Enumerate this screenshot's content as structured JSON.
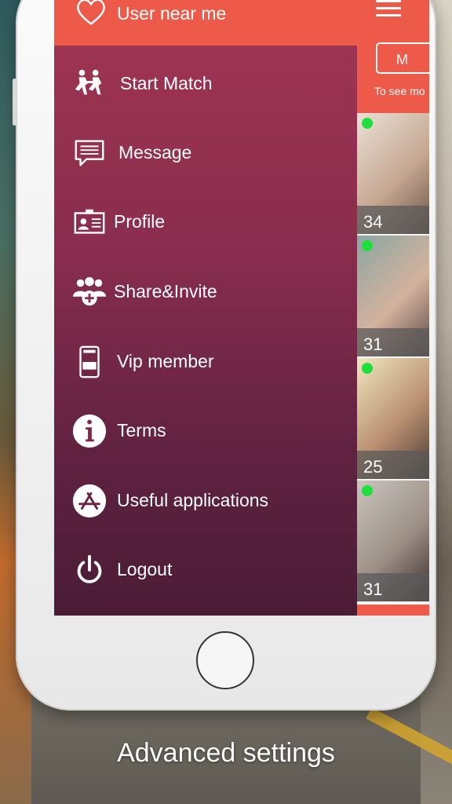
{
  "menu": {
    "header": {
      "label": "User near me",
      "icon": "heart-icon"
    },
    "items": [
      {
        "label": "Start Match",
        "icon": "running-people-icon"
      },
      {
        "label": "Message",
        "icon": "message-icon"
      },
      {
        "label": "Profile",
        "icon": "id-card-icon"
      },
      {
        "label": "Share&Invite",
        "icon": "group-add-icon"
      },
      {
        "label": "Vip member",
        "icon": "vip-card-icon"
      },
      {
        "label": "Terms",
        "icon": "info-icon"
      },
      {
        "label": "Useful applications",
        "icon": "app-store-icon"
      },
      {
        "label": "Logout",
        "icon": "power-icon"
      }
    ]
  },
  "content": {
    "filter_button": "M",
    "hint_text": "To see mo",
    "cards": [
      {
        "age": "34",
        "online": true
      },
      {
        "age": "31",
        "online": true
      },
      {
        "age": "25",
        "online": true
      },
      {
        "age": "31",
        "online": true
      }
    ]
  },
  "caption": "Advanced settings",
  "colors": {
    "accent": "#ee5a49",
    "menu_top": "#a23553",
    "menu_bottom": "#4a1c35",
    "online": "#1fe03a"
  }
}
